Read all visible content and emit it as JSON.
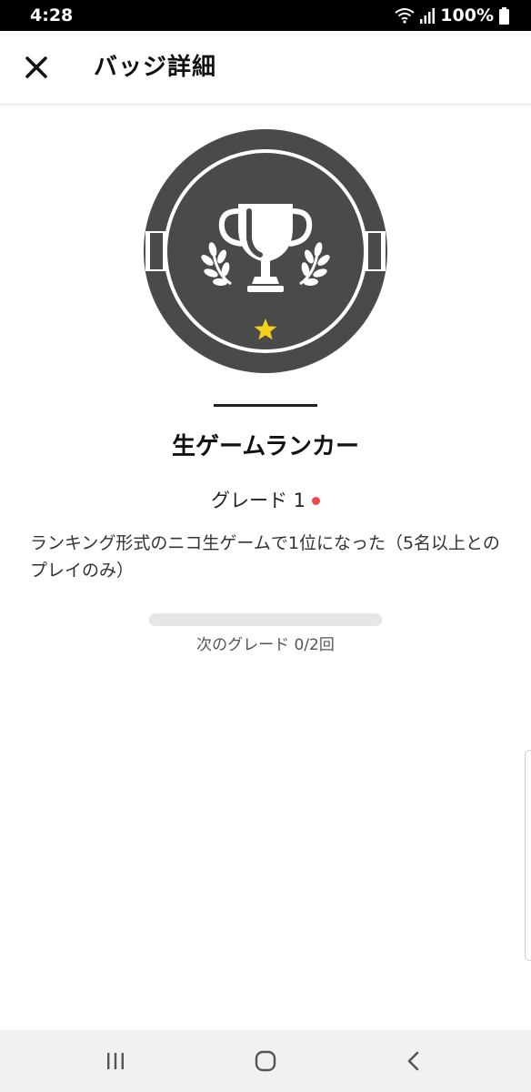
{
  "status_bar": {
    "time": "4:28",
    "battery_percent": "100%",
    "icons": [
      "wifi-icon",
      "signal-icon",
      "battery-icon"
    ]
  },
  "app_bar": {
    "title": "バッジ詳細",
    "close_icon": "close-icon"
  },
  "badge": {
    "icon": "trophy-with-laurel-icon",
    "grade_star_icon": "star-icon",
    "name": "生ゲームランカー",
    "grade_label": "グレード 1",
    "description": "ランキング形式のニコ生ゲームで1位になった（5名以上とのプレイのみ）"
  },
  "progress": {
    "label": "次のグレード 0/2回",
    "current": 0,
    "target": 2
  },
  "nav_bar": {
    "icons": [
      "recent-apps-icon",
      "home-icon",
      "back-icon"
    ]
  },
  "colors": {
    "badge_background": "#4a4a4a",
    "badge_ring": "#ffffff",
    "star": "#f3d11a",
    "grade_dot": "#f04848",
    "progress_track": "#e6e6e6"
  }
}
